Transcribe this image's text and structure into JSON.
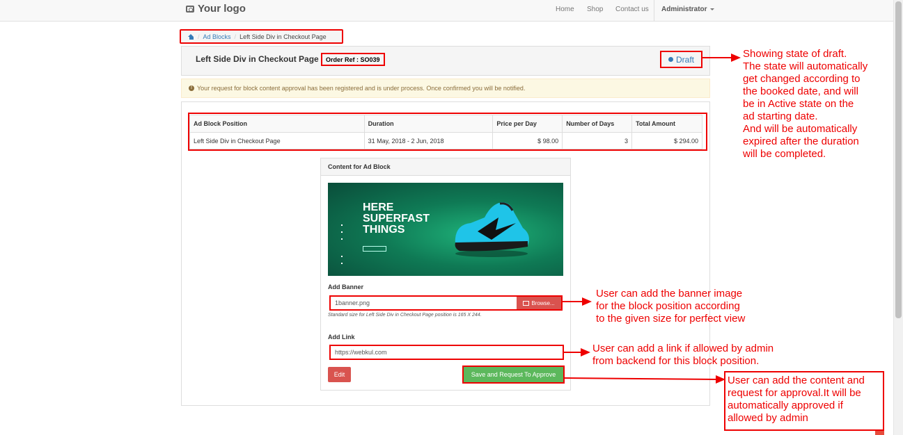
{
  "navbar": {
    "logo": "Your logo",
    "links": [
      "Home",
      "Shop",
      "Contact us"
    ],
    "admin": "Administrator"
  },
  "breadcrumb": {
    "items": [
      "Ad Blocks",
      "Left Side Div in Checkout Page"
    ]
  },
  "header": {
    "title": "Left Side Div in Checkout Page",
    "order_ref": "Order Ref : SO039",
    "status": "Draft"
  },
  "alert": {
    "text": "Your request for block content approval has been registered and is under process. Once confirmed you will be notified."
  },
  "table": {
    "headers": [
      "Ad Block Position",
      "Duration",
      "Price per Day",
      "Number of Days",
      "Total Amount"
    ],
    "rows": [
      [
        "Left Side Div in Checkout Page",
        "31 May, 2018 - 2 Jun, 2018",
        "$ 98.00",
        "3",
        "$ 294.00"
      ]
    ]
  },
  "content_card": {
    "title": "Content for Ad Block",
    "banner_lines": [
      "HERE",
      "SUPERFAST",
      "THINGS"
    ],
    "add_banner_label": "Add Banner",
    "file_value": "1banner.png",
    "browse_label": "Browse...",
    "hint": "Standard size for Left Side Div in Checkout Page position is 165 X 244.",
    "add_link_label": "Add Link",
    "link_value": "https://webkul.com",
    "edit_label": "Edit",
    "save_label": "Save and Request To Approve"
  },
  "annotations": {
    "draft": [
      "Showing state of draft.",
      "The state will automatically",
      "get changed according to",
      "the booked date, and will",
      "be in Active state on the",
      "ad starting date.",
      "And will be automatically",
      "expired after the duration",
      "will be completed."
    ],
    "banner": [
      "User can add the banner image",
      "for the block position according",
      "to the given size for perfect view"
    ],
    "link": [
      "User can add a link if allowed by admin",
      "from backend for this block position."
    ],
    "approve": [
      "User can add the content and",
      "request for approval.It will be",
      "automatically approved if",
      "allowed by admin"
    ]
  },
  "colors": {
    "annotation_red": "#e00000",
    "link_blue": "#337ab7",
    "danger": "#d9534f",
    "success": "#5cb85c"
  }
}
